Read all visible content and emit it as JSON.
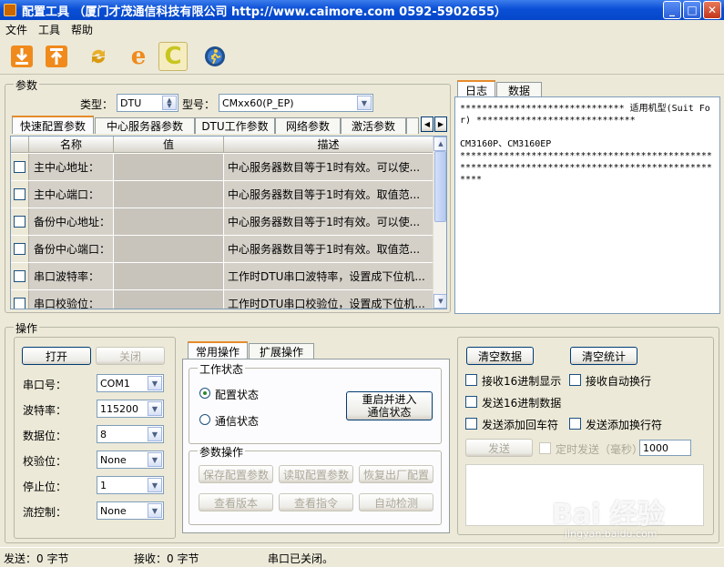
{
  "window": {
    "title": "配置工具  （厦门才茂通信科技有限公司   http://www.caimore.com   0592-5902655）"
  },
  "menu": [
    "文件",
    "工具",
    "帮助"
  ],
  "toolbar": {
    "icons": [
      "download-icon",
      "upload-icon",
      "refresh-icon",
      "e-icon",
      "c-icon",
      "runner-icon"
    ],
    "e_label": "e",
    "c_label": "C"
  },
  "params": {
    "legend": "参数",
    "type_label": "类型：",
    "type_value": "DTU",
    "model_label": "型号：",
    "model_value": "CMxx60(P_EP)",
    "tabs": [
      "快速配置参数",
      "中心服务器参数",
      "DTU工作参数",
      "网络参数",
      "激活参数"
    ],
    "columns": [
      "名称",
      "值",
      "描述"
    ],
    "rows": [
      {
        "name": "主中心地址：",
        "value": "",
        "desc": "中心服务器数目等于1时有效。可以使..."
      },
      {
        "name": "主中心端口：",
        "value": "",
        "desc": "中心服务器数目等于1时有效。取值范..."
      },
      {
        "name": "备份中心地址：",
        "value": "",
        "desc": "中心服务器数目等于1时有效。可以使..."
      },
      {
        "name": "备份中心端口：",
        "value": "",
        "desc": "中心服务器数目等于1时有效。取值范..."
      },
      {
        "name": "串口波特率：",
        "value": "",
        "desc": "工作时DTU串口波特率，设置成下位机..."
      },
      {
        "name": "串口校验位：",
        "value": "",
        "desc": "工作时DTU串口校验位，设置成下位机..."
      }
    ]
  },
  "log": {
    "tabs": [
      "日志",
      "数据"
    ],
    "text": "****************************** 适用机型(Suit For) *****************************\n\nCM3160P、CM3160EP\n************************************************************************************************"
  },
  "ops": {
    "legend": "操作",
    "open_label": "打开",
    "close_label": "关闭",
    "fields": [
      {
        "label": "串口号：",
        "value": "COM1"
      },
      {
        "label": "波特率：",
        "value": "115200"
      },
      {
        "label": "数据位：",
        "value": "8"
      },
      {
        "label": "校验位：",
        "value": "None"
      },
      {
        "label": "停止位：",
        "value": "1"
      },
      {
        "label": "流控制：",
        "value": "None"
      }
    ],
    "tabs": [
      "常用操作",
      "扩展操作"
    ],
    "work_state": {
      "legend": "工作状态",
      "config": "配置状态",
      "comm": "通信状态",
      "restart": "重启并进入\n通信状态"
    },
    "param_ops": {
      "legend": "参数操作",
      "buttons": [
        "保存配置参数",
        "读取配置参数",
        "恢复出厂配置",
        "查看版本",
        "查看指令",
        "自动检测"
      ]
    },
    "right": {
      "clear_data": "清空数据",
      "clear_stats": "清空统计",
      "hex_recv": "接收16进制显示",
      "auto_wrap": "接收自动换行",
      "hex_send": "发送16进制数据",
      "add_cr": "发送添加回车符",
      "add_lf": "发送添加换行符",
      "send": "发送",
      "timed_send": "定时发送（毫秒）",
      "interval": "1000"
    }
  },
  "status": {
    "sent": "发送：0 字节",
    "received": "接收：0 字节",
    "port_state": "串口已关闭。"
  },
  "watermark": {
    "text": "Bai 经验",
    "url": "jingyan.baidu.com"
  },
  "colors": {
    "titlebar": "#0a4fd6",
    "window_bg": "#ece9d8",
    "grid_row": "#d4d0c8",
    "active_tab": "#e68b2c"
  }
}
